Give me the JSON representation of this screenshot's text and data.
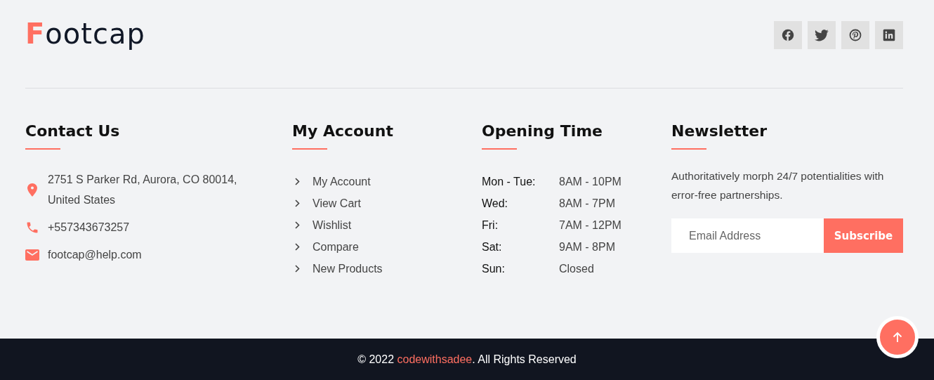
{
  "logo": {
    "accent": "F",
    "rest": "ootcap"
  },
  "social": [
    {
      "kind": "facebook"
    },
    {
      "kind": "twitter"
    },
    {
      "kind": "pinterest"
    },
    {
      "kind": "linkedin"
    }
  ],
  "contact": {
    "title": "Contact Us",
    "items": [
      {
        "kind": "location",
        "lines": [
          "2751 S Parker Rd, Aurora, CO 80014,",
          "United States"
        ]
      },
      {
        "kind": "phone",
        "lines": [
          "+557343673257"
        ]
      },
      {
        "kind": "email",
        "lines": [
          "footcap@help.com"
        ]
      }
    ]
  },
  "account": {
    "title": "My Account",
    "links": [
      "My Account",
      "View Cart",
      "Wishlist",
      "Compare",
      "New Products"
    ]
  },
  "opening": {
    "title": "Opening Time",
    "rows": [
      {
        "day": "Mon - Tue:",
        "hours": "8AM - 10PM"
      },
      {
        "day": "Wed:",
        "hours": "8AM - 7PM"
      },
      {
        "day": "Fri:",
        "hours": "7AM - 12PM"
      },
      {
        "day": "Sat:",
        "hours": "9AM - 8PM"
      },
      {
        "day": "Sun:",
        "hours": "Closed"
      }
    ]
  },
  "newsletter": {
    "title": "Newsletter",
    "text": "Authoritatively morph 24/7 potentialities with error-free partnerships.",
    "placeholder": "Email Address",
    "button": "Subscribe"
  },
  "copyright": {
    "prefix": "© 2022 ",
    "link": "codewithsadee",
    "suffix": ". All Rights Reserved"
  }
}
